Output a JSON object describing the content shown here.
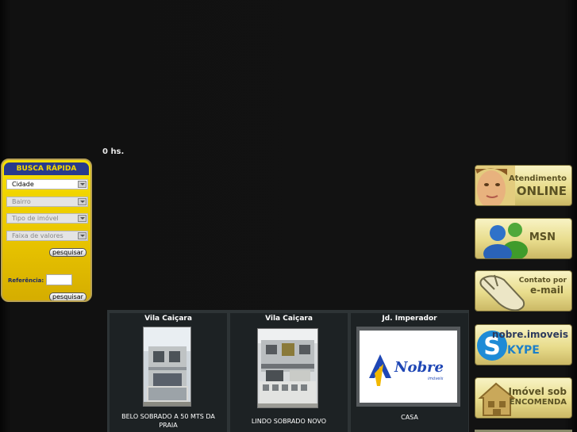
{
  "header": {
    "hours_text": "0 hs."
  },
  "busca": {
    "title": "BUSCA RÁPIDA",
    "selects": [
      "Cidade",
      "Bairro",
      "Tipo de imóvel",
      "Faixa de valores"
    ],
    "search_label": "pesquisar",
    "reference_label": "Referência:",
    "reference_value": "",
    "search2_label": "pesquisar"
  },
  "listings": [
    {
      "location": "Vila Caiçara",
      "description": "BELO SOBRADO A 50 MTS DA PRAIA"
    },
    {
      "location": "Vila Caiçara",
      "description": "LINDO SOBRADO NOVO"
    },
    {
      "location": "Jd. Imperador",
      "description": "CASA",
      "logo_text": "Nobre",
      "logo_sub": "imóveis"
    }
  ],
  "contact": {
    "online_top": "Atendimento",
    "online_bottom": "ONLINE",
    "msn": "MSN",
    "email_top": "Contato por",
    "email_bottom": "e-mail",
    "skype_user": "nobre.imoveis",
    "skype_word": "KYPE",
    "encomenda_top": "Imóvel sob",
    "encomenda_bottom": "ENCOMENDA"
  },
  "colors": {
    "panel_yellow": "#f0d200",
    "panel_blue": "#283a8c",
    "listing_bg": "#2e3436",
    "nobre_blue": "#1f47b5",
    "nobre_yellow": "#f2b800"
  }
}
